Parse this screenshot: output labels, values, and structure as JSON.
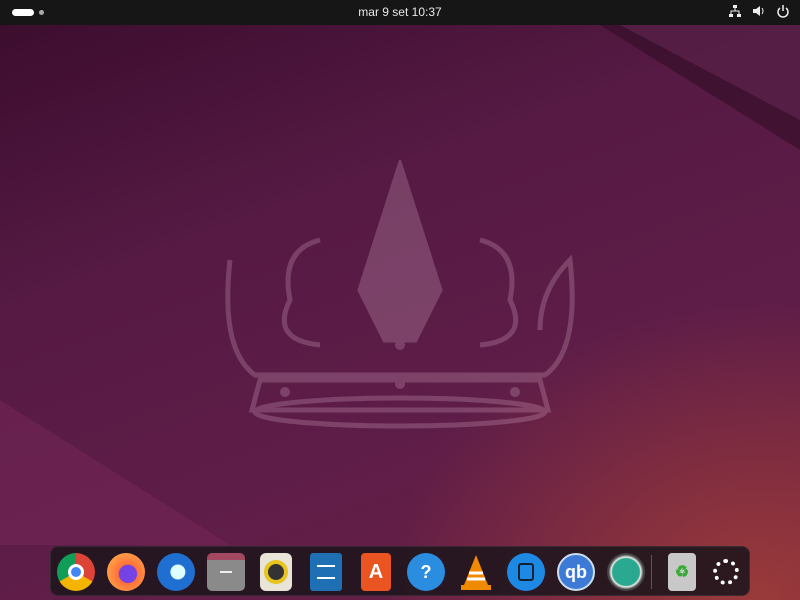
{
  "topbar": {
    "clock": "mar 9 set  10:37",
    "tray_icons": [
      "network-icon",
      "volume-icon",
      "power-icon"
    ]
  },
  "dock": {
    "apps": [
      {
        "name": "Google Chrome",
        "icon": "chrome-icon",
        "color": "#db4437"
      },
      {
        "name": "Firefox",
        "icon": "firefox-icon",
        "color": "#ff7139"
      },
      {
        "name": "Thunderbird",
        "icon": "thunderbird-icon",
        "color": "#1f6fd0"
      },
      {
        "name": "Files",
        "icon": "folder-icon",
        "color": "#8a8a8a"
      },
      {
        "name": "Rhythmbox",
        "icon": "rhythmbox-icon",
        "color": "#e8e4d8"
      },
      {
        "name": "LibreOffice Writer",
        "icon": "writer-icon",
        "color": "#1f6fb5"
      },
      {
        "name": "App Center",
        "icon": "app-center-icon",
        "color": "#e95420"
      },
      {
        "name": "Help",
        "icon": "help-icon",
        "color": "#2a8de0"
      },
      {
        "name": "VLC",
        "icon": "vlc-icon",
        "color": "#f08a00"
      },
      {
        "name": "Video Downloader",
        "icon": "video-download-icon",
        "color": "#1e88e5"
      },
      {
        "name": "qBittorrent",
        "icon": "qbittorrent-icon",
        "color": "#3d7ad6"
      },
      {
        "name": "BleachBit",
        "icon": "bleachbit-icon",
        "color": "#1a8c7c"
      },
      {
        "name": "Trash",
        "icon": "trash-icon",
        "color": "#c8c8c8"
      },
      {
        "name": "Show Apps",
        "icon": "show-apps-icon",
        "color": "#ffffff"
      }
    ],
    "qb_label": "qb",
    "help_label": "?"
  }
}
